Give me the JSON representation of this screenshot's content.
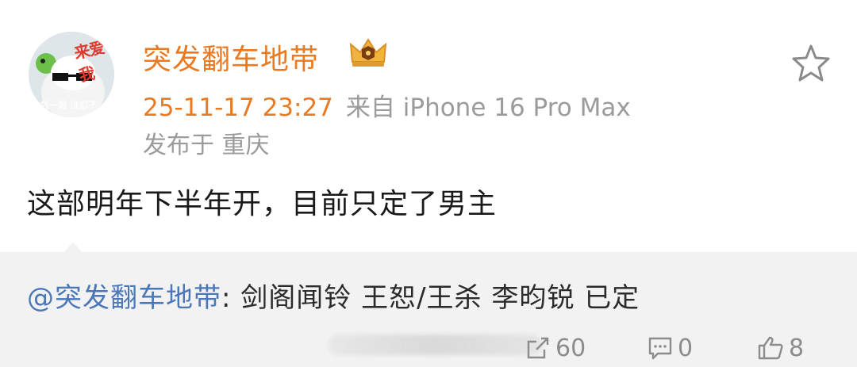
{
  "post": {
    "username": "突发翻车地带",
    "timestamp": "25-11-17 23:27",
    "source": "来自 iPhone 16 Pro Max",
    "location": "发布于 重庆",
    "content": "这部明年下半年开，目前只定了男主",
    "avatar_text": "来爱我",
    "avatar_subtext": "戴一戴 谁都不"
  },
  "repost": {
    "mention": "@突发翻车地带",
    "text": ": 剑阁闻铃 王恕/王杀 李昀锐 已定"
  },
  "actions": {
    "repost_count": "60",
    "comment_count": "0",
    "like_count": "8"
  },
  "colors": {
    "username": "#ea7a21",
    "mention": "#4b77b8",
    "meta": "#9b9b9b",
    "repost_bg": "#f2f2f2"
  },
  "icons": [
    "avatar",
    "vip-crown-icon",
    "star-icon",
    "repost-icon",
    "comment-icon",
    "like-icon"
  ]
}
